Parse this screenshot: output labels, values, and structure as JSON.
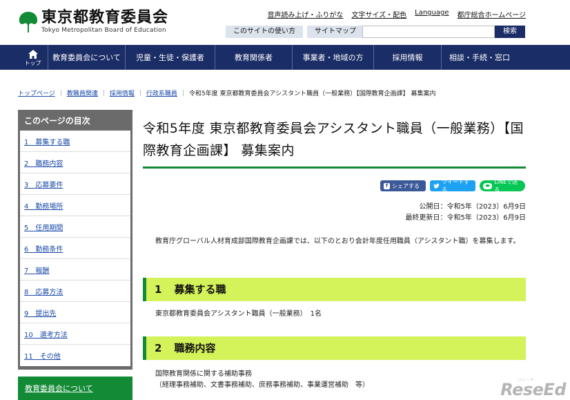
{
  "header": {
    "logo_jp": "東京都教育委員会",
    "logo_en": "Tokyo Metropolitan Board of Education",
    "util_links": [
      "音声読み上げ・ふりがな",
      "文字サイズ・配色",
      "Language",
      "都庁総合ホームページ"
    ],
    "sub_buttons": [
      "このサイトの使い方",
      "サイトマップ"
    ],
    "search_placeholder": "",
    "search_button": "検索"
  },
  "nav": {
    "home_label": "トップ",
    "items": [
      "教育委員会について",
      "児童・生徒・保護者",
      "教育関係者",
      "事業者・地域の方",
      "採用情報",
      "相談・手続・窓口"
    ]
  },
  "breadcrumb": {
    "links": [
      "トップページ",
      "教職員関連",
      "採用情報",
      "行政系職員"
    ],
    "current": "令和5年度 東京都教育委員会アシスタント職員（一般業務）【国際教育企画課】 募集案内",
    "separator": "｜"
  },
  "sidebar": {
    "title": "このページの目次",
    "items": [
      "1　募集する職",
      "2　職務内容",
      "3　応募要件",
      "4　勤務場所",
      "5　任用期間",
      "6　勤務条件",
      "7　報酬",
      "8　応募方法",
      "9　提出先",
      "10　選考方法",
      "11　その他"
    ],
    "green_link": "教育委員会について"
  },
  "main": {
    "title": "令和5年度 東京都教育委員会アシスタント職員（一般業務）【国際教育企画課】 募集案内",
    "share": {
      "facebook": "シェアする",
      "twitter": "ツイートする",
      "line": "LINEで送る"
    },
    "published": "公開日：令和5年（2023）6月9日",
    "updated": "最終更新日：令和5年（2023）6月9日",
    "lead": "教育庁グローバル人材育成部国際教育企画課では、以下のとおり会計年度任用職員（アシスタント職）を募集します。",
    "sections": [
      {
        "num": "1",
        "title": "募集する職",
        "body": [
          "東京都教育委員会アシスタント職員（一般業務）　1名"
        ]
      },
      {
        "num": "2",
        "title": "職務内容",
        "body": [
          "国際教育関係に関する補助事務",
          "（経理事務補助、文書事務補助、庶務事務補助、事業運営補助　等）"
        ]
      }
    ]
  },
  "watermark": {
    "text": "ReseEd",
    "small": "リシード"
  },
  "colors": {
    "navy": "#1b2d66",
    "green": "#138a36",
    "lime": "#d4f25a",
    "link": "#1a4aa8"
  }
}
